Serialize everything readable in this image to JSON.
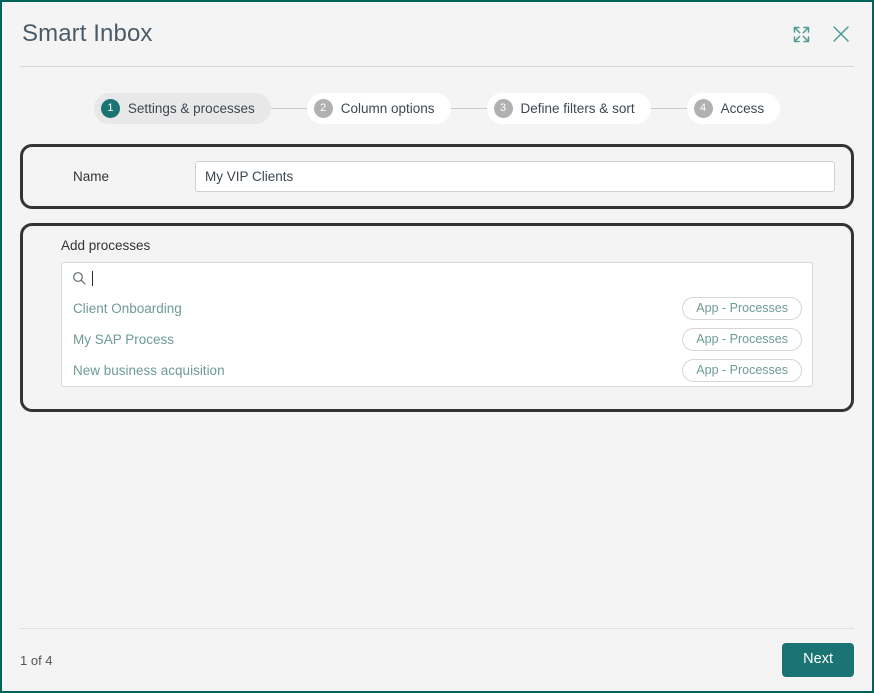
{
  "window": {
    "title": "Smart Inbox",
    "accent_color": "#1b7373",
    "border_color": "#00635a",
    "background_color": "#f4f4f4"
  },
  "header": {
    "expand_icon": "expand-icon",
    "close_icon": "close-icon"
  },
  "stepper": {
    "steps": [
      {
        "number": "1",
        "label": "Settings & processes",
        "active": true
      },
      {
        "number": "2",
        "label": "Column options",
        "active": false
      },
      {
        "number": "3",
        "label": "Define filters & sort",
        "active": false
      },
      {
        "number": "4",
        "label": "Access",
        "active": false
      }
    ]
  },
  "name_section": {
    "label": "Name",
    "value": "My VIP Clients",
    "placeholder": ""
  },
  "processes_section": {
    "label": "Add processes",
    "search": {
      "icon": "search-icon",
      "value": "",
      "placeholder": ""
    },
    "items": [
      {
        "name": "Client Onboarding",
        "badge": "App - Processes"
      },
      {
        "name": "My SAP Process",
        "badge": "App - Processes"
      },
      {
        "name": "New business acquisition",
        "badge": "App - Processes"
      }
    ]
  },
  "footer": {
    "page_count": "1 of 4",
    "next_label": "Next"
  }
}
